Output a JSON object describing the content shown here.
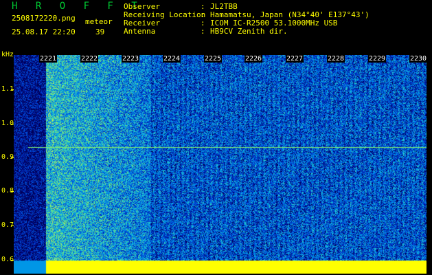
{
  "header": {
    "brand": "H R O F F T",
    "filename": "2508172220.png",
    "mode": "meteor",
    "timestamp": "25.08.17 22:20",
    "count": "39",
    "meta": [
      {
        "key": "Observer",
        "value": "JL2TBB"
      },
      {
        "key": "Receiving Location",
        "value": "Hamamatsu, Japan (N34°40' E137°43')"
      },
      {
        "key": "Receiver",
        "value": "ICOM IC-R2500 53.1000MHz USB"
      },
      {
        "key": "Antenna",
        "value": "HB9CV Zenith dir."
      }
    ]
  },
  "axes": {
    "y_unit": "kHz",
    "y_ticks": [
      "1.1",
      "1.0",
      "0.9",
      "0.8",
      "0.7",
      "0.6"
    ],
    "x_ticks": [
      "2221",
      "2222",
      "2223",
      "2224",
      "2225",
      "2226",
      "2227",
      "2228",
      "2229",
      "2230"
    ]
  },
  "colors": {
    "background": "#000000",
    "label": "#ffff00",
    "brand": "#00cc33"
  }
}
